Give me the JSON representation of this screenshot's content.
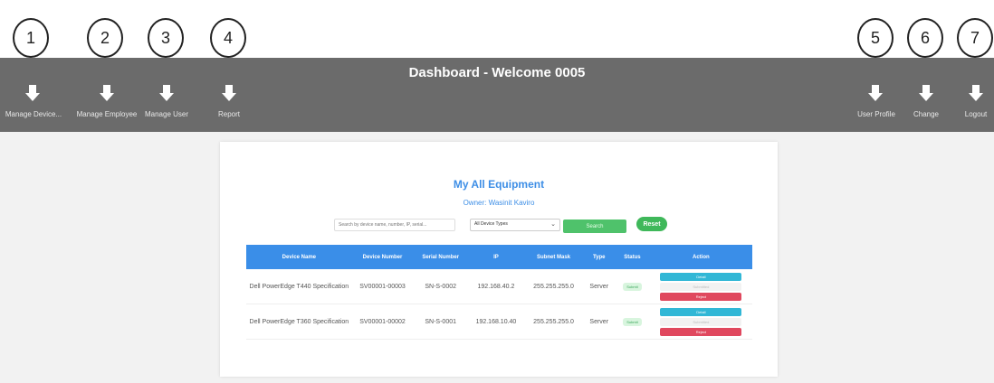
{
  "header": {
    "title": "Dashboard - Welcome 0005"
  },
  "callouts": [
    "1",
    "2",
    "3",
    "4",
    "5",
    "6",
    "7"
  ],
  "nav": {
    "manage_device": "Manage Device...",
    "manage_employee": "Manage Employee",
    "manage_user": "Manage User",
    "report": "Report",
    "user_profile": "User Profile",
    "change": "Change",
    "logout": "Logout"
  },
  "main": {
    "title": "My All Equipment",
    "owner": "Owner: Wasinit Kaviro",
    "search_placeholder": "Search by device name, number, IP, serial...",
    "device_type_selected": "All Device Types",
    "search_button": "Search",
    "reset_button": "Reset"
  },
  "table": {
    "headers": [
      "Device Name",
      "Device Number",
      "Serial Number",
      "IP",
      "Subnet Mask",
      "Type",
      "Status",
      "Action"
    ],
    "rows": [
      {
        "device_name": "Dell PowerEdge T440 Specification",
        "device_number": "SV00001-00003",
        "serial": "SN-S-0002",
        "ip": "192.168.40.2",
        "subnet": "255.255.255.0",
        "type": "Server",
        "status": "Submit"
      },
      {
        "device_name": "Dell PowerEdge T360 Specification",
        "device_number": "SV00001-00002",
        "serial": "SN-S-0001",
        "ip": "192.168.10.40",
        "subnet": "255.255.255.0",
        "type": "Server",
        "status": "Submit"
      }
    ],
    "action_labels": {
      "detail": "Detail",
      "submit": "Submitted",
      "reject": "Reject"
    }
  }
}
